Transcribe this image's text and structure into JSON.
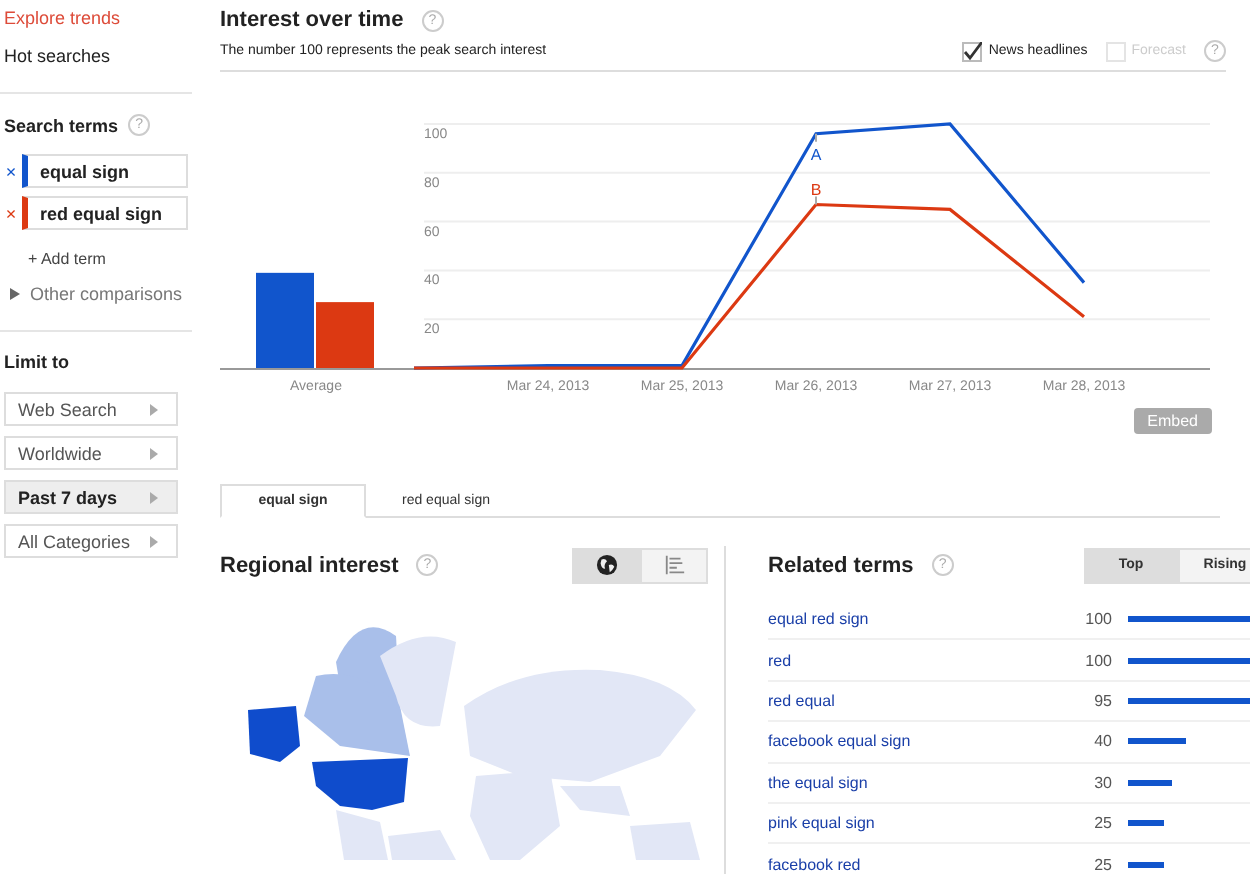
{
  "sidebar": {
    "links": [
      {
        "label": "Explore trends",
        "selected": true
      },
      {
        "label": "Hot searches",
        "selected": false
      }
    ],
    "search_terms": {
      "title": "Search terms",
      "help": "?",
      "terms": [
        {
          "remove": "×",
          "label": "equal sign",
          "color": "#1155cc"
        },
        {
          "remove": "×",
          "label": "red equal sign",
          "color": "#dc3912"
        }
      ],
      "add": "+ Add term",
      "other": "Other comparisons"
    },
    "limit": {
      "title": "Limit to",
      "filters": [
        {
          "label": "Web Search",
          "selected": false
        },
        {
          "label": "Worldwide",
          "selected": false
        },
        {
          "label": "Past 7 days",
          "selected": true
        },
        {
          "label": "All Categories",
          "selected": false
        }
      ]
    }
  },
  "interest": {
    "title": "Interest over time",
    "help": "?",
    "subtitle": "The number 100 represents the peak search interest",
    "options": [
      {
        "label": "News headlines",
        "checked": true,
        "disabled": false
      },
      {
        "label": "Forecast",
        "checked": false,
        "disabled": true
      }
    ],
    "option_help": "?",
    "average": {
      "chart_data": {
        "type": "bar",
        "categories": [
          "Average"
        ],
        "ylim": [
          0,
          100
        ],
        "series": [
          {
            "color": "#1155cc",
            "values": [
              39
            ]
          },
          {
            "color": "#dc3912",
            "values": [
              27
            ]
          }
        ]
      }
    },
    "chart_data": {
      "type": "line",
      "categories": [
        null,
        "Mar 24, 2013",
        "Mar 25, 2013",
        "Mar 26, 2013",
        "Mar 27, 2013",
        "Mar 28, 2013"
      ],
      "ylim": [
        0,
        100
      ],
      "yticks": [
        {
          "value": 20,
          "label": "20"
        },
        {
          "value": 40,
          "label": "40"
        },
        {
          "value": 60,
          "label": "60"
        },
        {
          "value": 80,
          "label": "80"
        },
        {
          "value": 100,
          "label": "100"
        }
      ],
      "series": [
        {
          "color": "#1155cc",
          "values": [
            0,
            1,
            1,
            96,
            100,
            35
          ]
        },
        {
          "color": "#dc3912",
          "values": [
            0,
            0,
            0,
            67,
            65,
            21
          ]
        }
      ],
      "grid": true,
      "annotations": [
        {
          "x": "Mar 26, 2013",
          "y": 96,
          "text": "A"
        },
        {
          "x": "Mar 26, 2013",
          "y": 67,
          "text": "B"
        }
      ]
    },
    "embed": "Embed"
  },
  "tabs": [
    {
      "label": "equal sign",
      "selected": true
    },
    {
      "label": "red equal sign",
      "selected": false
    }
  ],
  "regional": {
    "title": "Regional interest",
    "help": "?",
    "views": [
      {
        "kind": "map",
        "selected": true
      },
      {
        "kind": "list",
        "selected": false
      }
    ]
  },
  "related": {
    "title": "Related terms",
    "help": "?",
    "views": [
      {
        "label": "Top",
        "selected": true
      },
      {
        "label": "Rising",
        "selected": false
      }
    ],
    "rows": [
      {
        "term": "equal red sign",
        "value": "100"
      },
      {
        "term": "red",
        "value": "100"
      },
      {
        "term": "red equal",
        "value": "95"
      },
      {
        "term": "facebook equal sign",
        "value": "40"
      },
      {
        "term": "the equal sign",
        "value": "30"
      },
      {
        "term": "pink equal sign",
        "value": "25"
      },
      {
        "term": "facebook red",
        "value": "25"
      }
    ]
  }
}
